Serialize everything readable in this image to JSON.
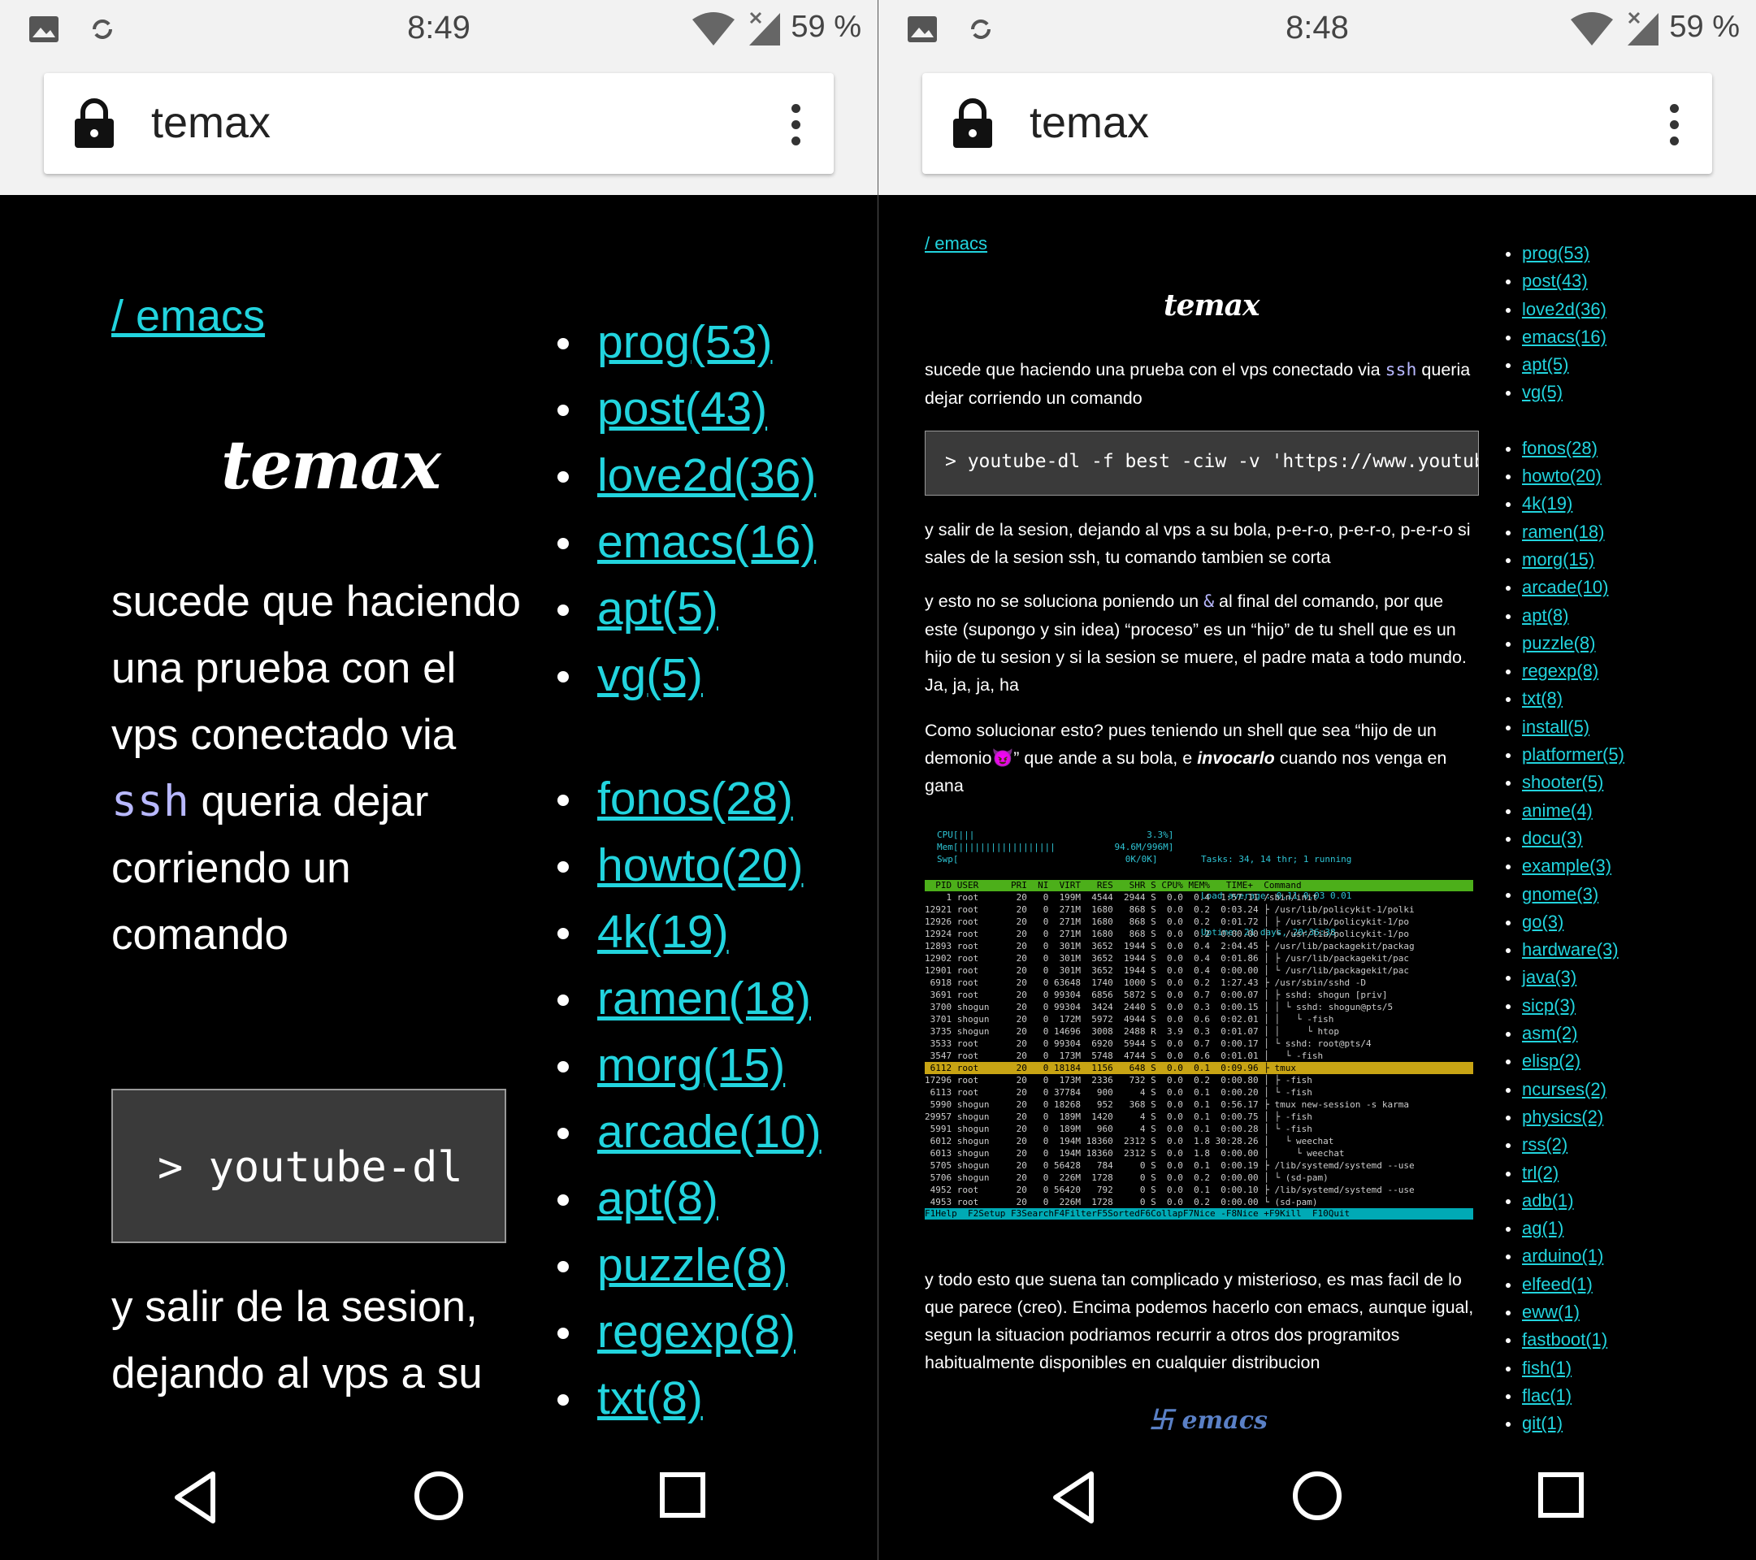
{
  "left": {
    "status": {
      "time": "8:49",
      "battery": "59 %"
    },
    "browser": {
      "url": "temax"
    },
    "breadcrumb": "/ emacs",
    "logo": "temax",
    "para1_before": "sucede que haciendo una prueba con el vps conectado via ",
    "para1_code": "ssh",
    "para1_after": " queria dejar corriendo un comando",
    "code": "> youtube-dl",
    "para2": "y salir de la sesion, dejando al vps a su",
    "tags_a": [
      "prog(53)",
      "post(43)",
      "love2d(36)",
      "emacs(16)",
      "apt(5)",
      "vg(5)"
    ],
    "tags_b": [
      "fonos(28)",
      "howto(20)",
      "4k(19)",
      "ramen(18)",
      "morg(15)",
      "arcade(10)",
      "apt(8)",
      "puzzle(8)",
      "regexp(8)",
      "txt(8)"
    ]
  },
  "right": {
    "status": {
      "time": "8:48",
      "battery": "59 %"
    },
    "browser": {
      "url": "temax"
    },
    "breadcrumb": "/ emacs",
    "logo": "temax",
    "p1_before": "sucede que haciendo una prueba con el vps conectado via ",
    "p1_code": "ssh",
    "p1_after": " queria dejar corriendo un comando",
    "code": "> youtube-dl -f best -ciw -v 'https://www.youtub",
    "p2": "y salir de la sesion, dejando al vps a su bola, p-e-r-o, p-e-r-o, p-e-r-o si sales de la sesion ssh, tu comando tambien se corta",
    "p3_before": "y esto no se soluciona poniendo un ",
    "p3_code": "&",
    "p3_after": " al final del comando, por que este (supongo y sin idea) “proceso” es un “hijo” de tu shell que es un hijo de tu sesion y si la sesion se muere, el padre mata a todo mundo. Ja, ja, ja, ha",
    "p4_before": "Como solucionar esto? pues teniendo un shell que sea “hijo de un demonio",
    "p4_emoji": "😈",
    "p4_mid": "” que ande a su bola, e ",
    "p4_em": "invocarlo",
    "p4_after": " cuando nos venga en gana",
    "p5": "y todo esto que suena tan complicado y misterioso, es mas facil de lo que parece (creo). Encima podemos hacerlo con emacs, aunque igual, segun la situacion podriamos recurrir a otros dos programitos habitualmente disponibles en cualquier distribucion",
    "emacs_logo": "emacs",
    "tags_a": [
      "prog(53)",
      "post(43)",
      "love2d(36)",
      "emacs(16)",
      "apt(5)",
      "vg(5)"
    ],
    "tags_b": [
      "fonos(28)",
      "howto(20)",
      "4k(19)",
      "ramen(18)",
      "morg(15)",
      "arcade(10)",
      "apt(8)",
      "puzzle(8)",
      "regexp(8)",
      "txt(8)",
      "install(5)",
      "platformer(5)",
      "shooter(5)",
      "anime(4)",
      "docu(3)",
      "example(3)",
      "gnome(3)",
      "go(3)",
      "hardware(3)",
      "java(3)",
      "sicp(3)",
      "asm(2)",
      "elisp(2)",
      "ncurses(2)",
      "physics(2)",
      "rss(2)",
      "trl(2)",
      "adb(1)",
      "ag(1)",
      "arduino(1)",
      "elfeed(1)",
      "eww(1)",
      "fastboot(1)",
      "fish(1)",
      "flac(1)",
      "git(1)"
    ],
    "htop": {
      "meters": [
        "CPU[|||                                3.3%]",
        "Mem[||||||||||||||||||           94.6M/996M]",
        "Swp[                               0K/0K]"
      ],
      "stats": [
        "Tasks: 34, 14 thr; 1 running",
        "Load average: 0.11 0.03 0.01",
        "Uptime: 21 days, 20:36:38"
      ],
      "header": "  PID USER      PRI  NI  VIRT   RES   SHR S CPU% MEM%   TIME+  Command",
      "rows": [
        "    1 root       20   0  199M  4544  2944 S  0.0  0.4  1:57.11 /sbin/init",
        "12921 root       20   0  271M  1680   868 S  0.0  0.2  0:03.24 ├ /usr/lib/policykit-1/polki",
        "12926 root       20   0  271M  1680   868 S  0.0  0.2  0:01.72 │ ├ /usr/lib/policykit-1/po",
        "12924 root       20   0  271M  1680   868 S  0.0  0.2  0:00.00 │ └ /usr/lib/policykit-1/po",
        "12893 root       20   0  301M  3652  1944 S  0.0  0.4  2:04.45 ├ /usr/lib/packagekit/packag",
        "12902 root       20   0  301M  3652  1944 S  0.0  0.4  0:01.86 │ ├ /usr/lib/packagekit/pac",
        "12901 root       20   0  301M  3652  1944 S  0.0  0.4  0:00.00 │ └ /usr/lib/packagekit/pac",
        " 6918 root       20   0 63648  1740  1000 S  0.0  0.2  1:27.43 ├ /usr/sbin/sshd -D",
        " 3691 root       20   0 99304  6856  5872 S  0.0  0.7  0:00.07 │ ├ sshd: shogun [priv]",
        " 3700 shogun     20   0 99304  3424  2440 S  0.0  0.3  0:00.15 │ │ └ sshd: shogun@pts/5",
        " 3701 shogun     20   0  172M  5972  4944 S  0.0  0.6  0:02.01 │ │   └ -fish",
        " 3735 shogun     20   0 14696  3008  2488 R  3.9  0.3  0:01.07 │ │     └ htop",
        " 3533 root       20   0 99304  6920  5944 S  0.0  0.7  0:00.17 │ └ sshd: root@pts/4",
        " 3547 root       20   0  173M  5748  4744 S  0.0  0.6  0:01.01 │   └ -fish",
        " 6112 root       20   0 18184  1156   648 S  0.0  0.1  0:09.96 ├ tmux",
        "17296 root       20   0  173M  2336   732 S  0.0  0.2  0:00.80 │ ├ -fish",
        " 6113 root       20   0 37784   900     4 S  0.0  0.1  0:00.20 │ └ -fish",
        " 5990 shogun     20   0 18268   952   368 S  0.0  0.1  0:56.17 ├ tmux new-session -s karma",
        "29957 shogun     20   0  189M  1420     4 S  0.0  0.1  0:00.75 │ ├ -fish",
        " 5991 shogun     20   0  189M   960     4 S  0.0  0.1  0:00.28 │ └ -fish",
        " 6012 shogun     20   0  194M 18360  2312 S  0.0  1.8 30:28.26 │   └ weechat",
        " 6013 shogun     20   0  194M 18360  2312 S  0.0  1.8  0:00.00 │     └ weechat",
        " 5705 shogun     20   0 56428   784     0 S  0.0  0.1  0:00.19 ├ /lib/systemd/systemd --use",
        " 5706 shogun     20   0  226M  1728     0 S  0.0  0.2  0:00.00 │ └ (sd-pam)",
        " 4952 root       20   0 56420   792     0 S  0.0  0.1  0:00.10 ├ /lib/systemd/systemd --use",
        " 4953 root       20   0  226M  1728     0 S  0.0  0.2  0:00.00 └ (sd-pam)"
      ],
      "selected_row": 14,
      "fkeys": "F1Help  F2Setup F3SearchF4FilterF5SortedF6CollapF7Nice -F8Nice +F9Kill  F10Quit"
    }
  }
}
